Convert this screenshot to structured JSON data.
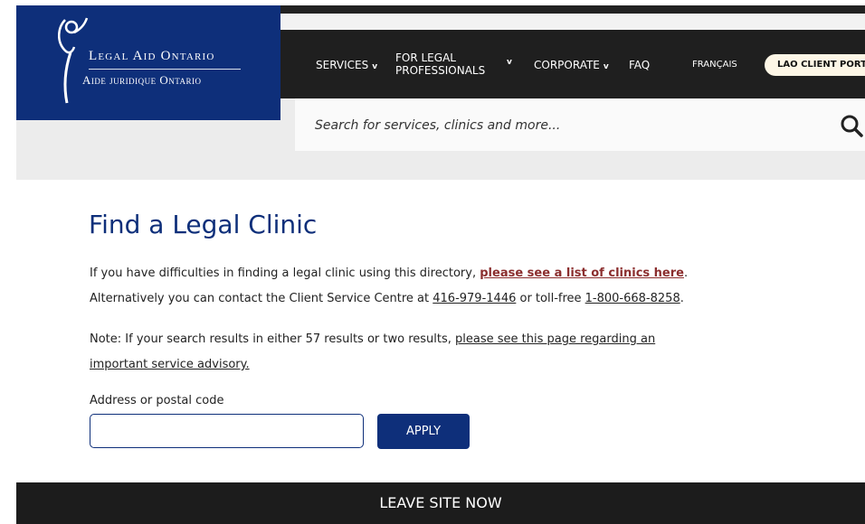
{
  "brand": {
    "name_en": "Legal Aid Ontario",
    "name_fr": "Aide juridique Ontario",
    "color": "#0e2f7a"
  },
  "nav": {
    "items": [
      {
        "label": "SERVICES",
        "icon": "chevron-down-icon"
      },
      {
        "label": "FOR LEGAL",
        "label2": "PROFESSIONALS",
        "icon": "chevron-down-icon"
      },
      {
        "label": "CORPORATE",
        "icon": "chevron-down-icon"
      },
      {
        "label": "FAQ"
      }
    ],
    "language": "FRANÇAIS",
    "portal_button": "LAO CLIENT PORTAL",
    "chevron_glyph": "v"
  },
  "search": {
    "placeholder": "Search for services, clinics and more...",
    "icon": "search-icon"
  },
  "main": {
    "title": "Find a Legal Clinic",
    "para1_prefix": "If you have difficulties in finding a legal clinic using this directory, ",
    "para1_link": "please see a list of clinics here",
    "para1_suffix": ".",
    "para2_prefix": "Alternatively you can contact the Client Service Centre at ",
    "para2_phone1": "416-979-1446",
    "para2_mid": " or toll-free ",
    "para2_phone2": "1-800-668-8258",
    "para2_suffix": ".",
    "note_prefix": "Note: If your search results in either 57 results or two results, ",
    "note_link_part1": "please see this page regarding an",
    "note_link_part2": "important service advisory.",
    "address_label": "Address or postal code",
    "address_value": "",
    "apply_label": "APPLY"
  },
  "footer": {
    "leave_label": "LEAVE SITE NOW"
  }
}
